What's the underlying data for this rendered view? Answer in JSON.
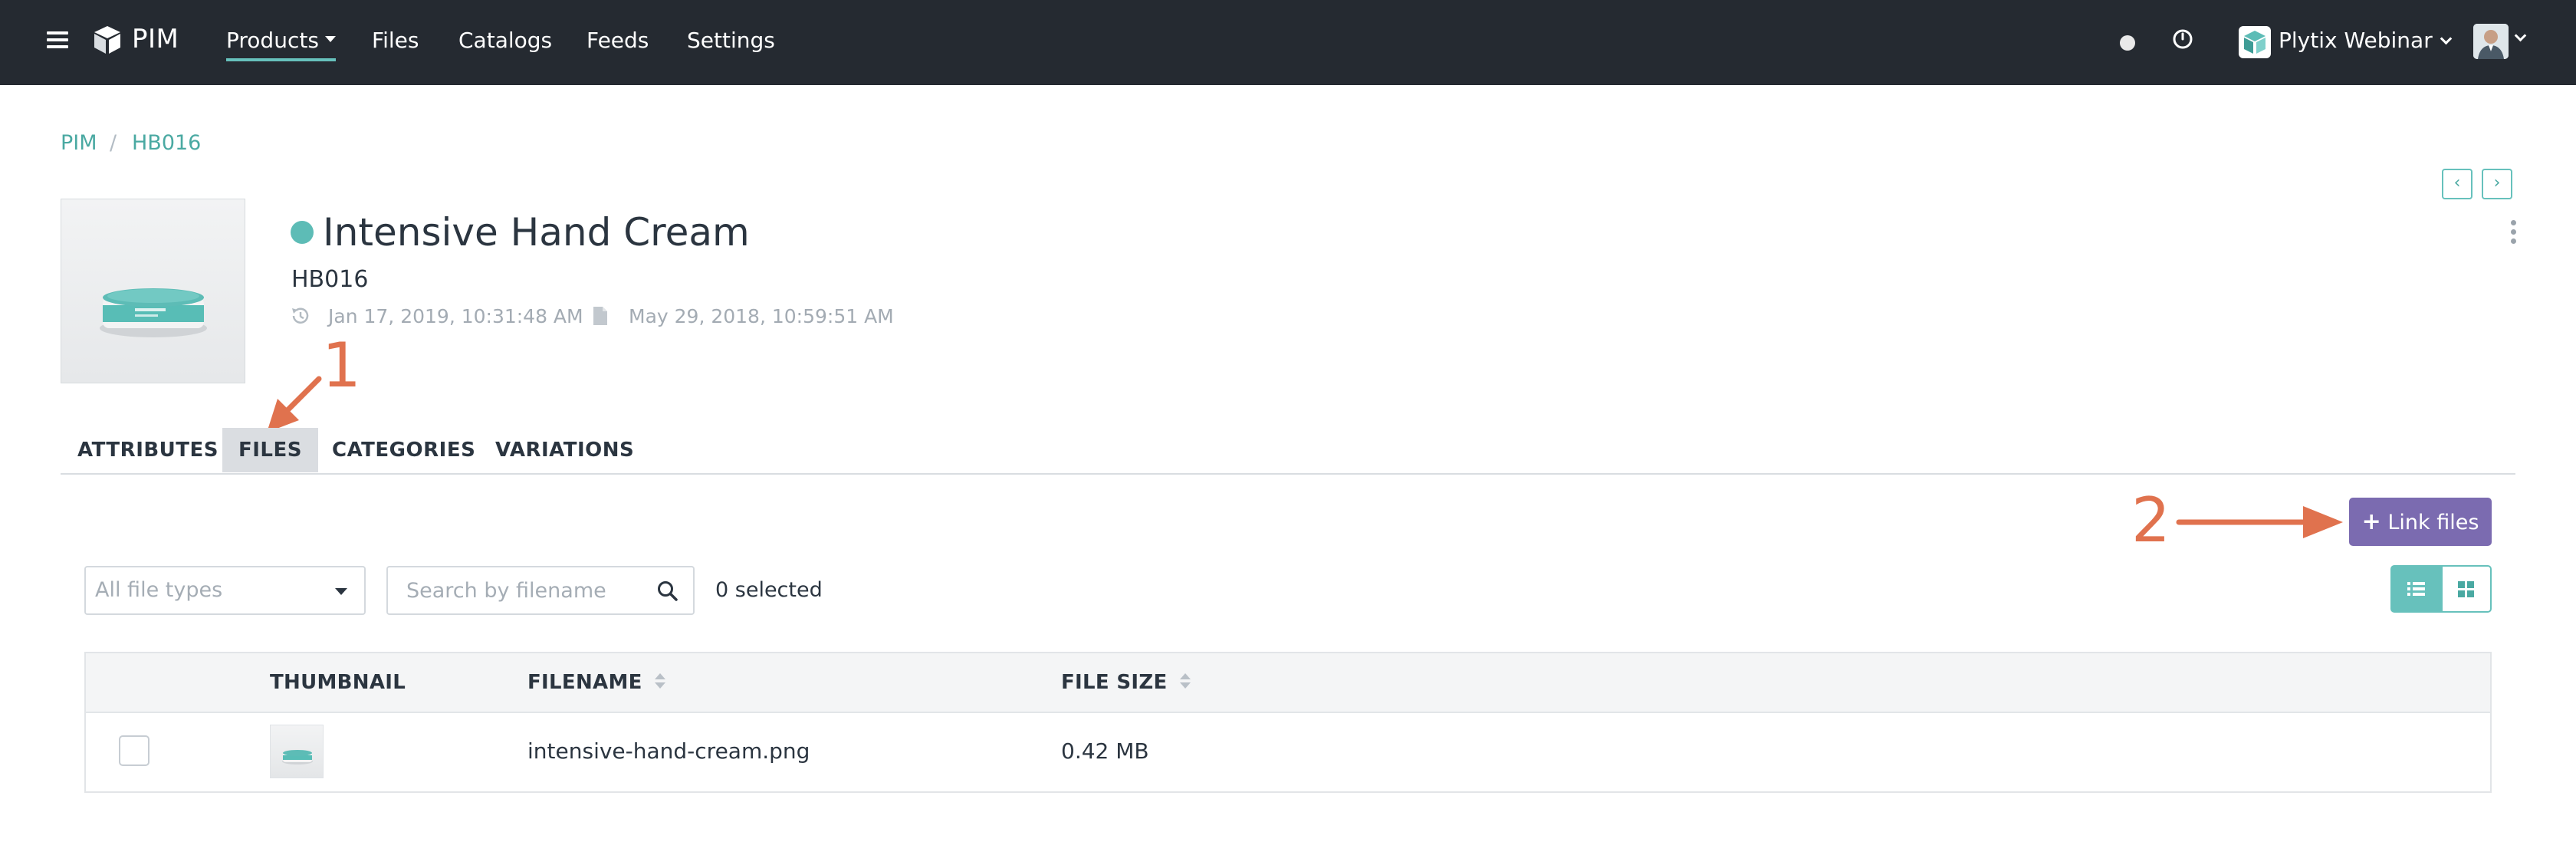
{
  "topbar": {
    "brand": "PIM",
    "nav": [
      {
        "label": "Products",
        "active": true,
        "has_dropdown": true
      },
      {
        "label": "Files"
      },
      {
        "label": "Catalogs"
      },
      {
        "label": "Feeds"
      },
      {
        "label": "Settings"
      }
    ],
    "org_name": "Plytix Webinar",
    "icons": [
      "menu-icon",
      "logo-icon",
      "status-dot",
      "timer-icon",
      "org-icon",
      "user-avatar"
    ]
  },
  "breadcrumb": {
    "items": [
      "PIM",
      "HB016"
    ],
    "separator": "/"
  },
  "product": {
    "title": "Intensive Hand Cream",
    "sku": "HB016",
    "modified": "Jan 17, 2019, 10:31:48 AM",
    "created": "May 29, 2018, 10:59:51 AM",
    "status_color": "#5dbcb6"
  },
  "annotations": {
    "step1": "1",
    "step2": "2",
    "color": "#e0724e"
  },
  "tabs": [
    {
      "label": "ATTRIBUTES"
    },
    {
      "label": "FILES",
      "active": true
    },
    {
      "label": "CATEGORIES"
    },
    {
      "label": "VARIATIONS"
    }
  ],
  "toolbar": {
    "link_files_label": "Link files",
    "link_files_color": "#7b6bb0",
    "filter_placeholder": "All file types",
    "search_placeholder": "Search by filename",
    "selected_text": "0 selected",
    "view_mode": "list"
  },
  "table": {
    "columns": [
      "THUMBNAIL",
      "FILENAME",
      "FILE SIZE"
    ],
    "rows": [
      {
        "filename": "intensive-hand-cream.png",
        "file_size": "0.42 MB",
        "selected": false
      }
    ]
  },
  "colors": {
    "accent": "#67c1bc",
    "topbar_bg": "#252a31"
  }
}
